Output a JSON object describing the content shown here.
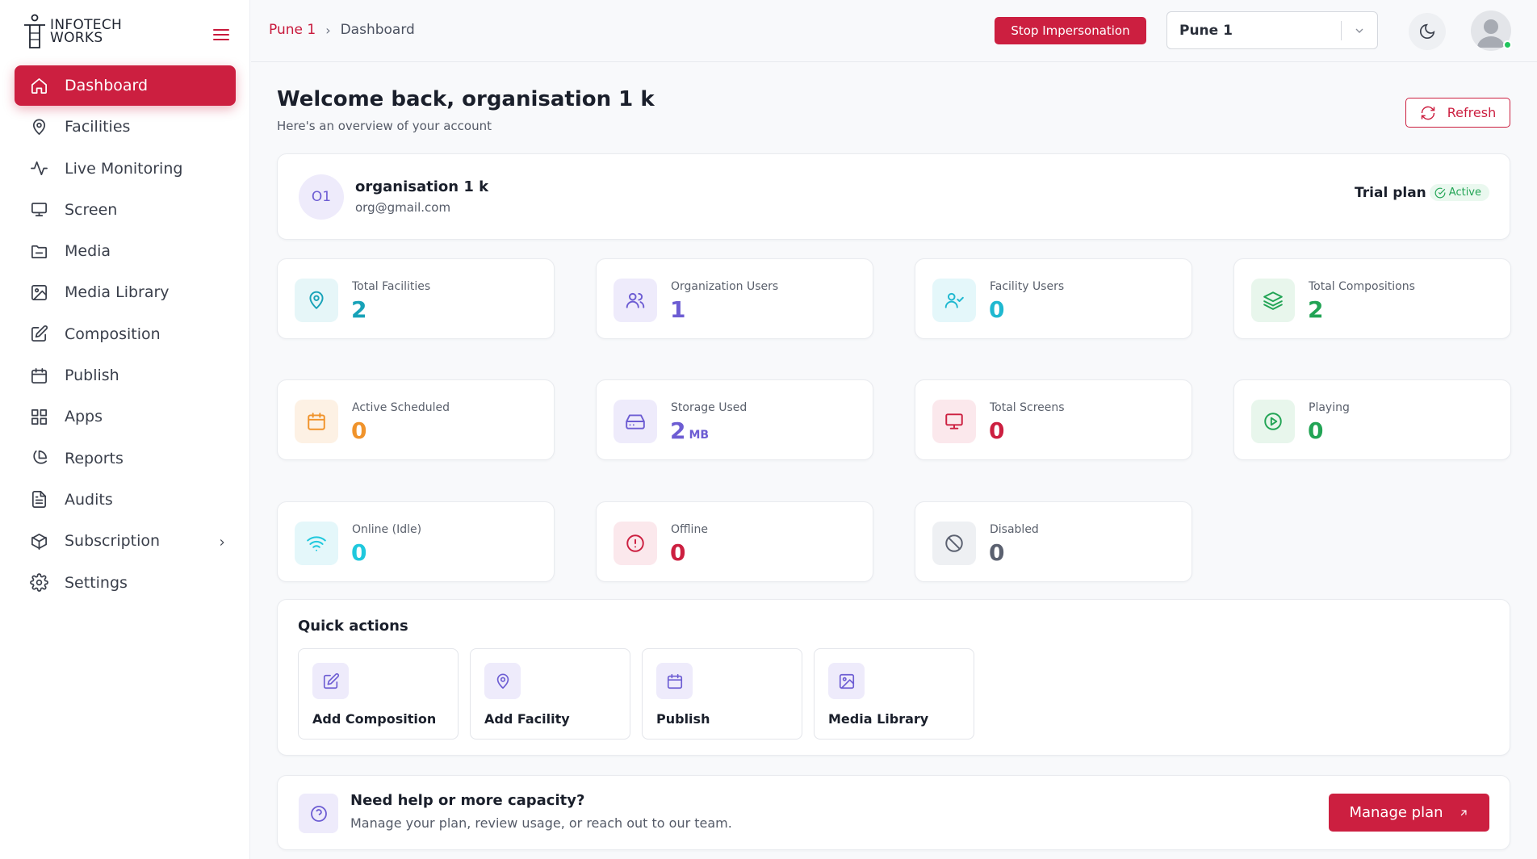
{
  "brand": {
    "line1": "INFOTECH",
    "line2": "WORKS"
  },
  "sidebar": {
    "items": [
      {
        "label": "Dashboard",
        "icon": "home-icon",
        "active": true
      },
      {
        "label": "Facilities",
        "icon": "map-pin-icon"
      },
      {
        "label": "Live Monitoring",
        "icon": "activity-icon"
      },
      {
        "label": "Screen",
        "icon": "monitor-icon"
      },
      {
        "label": "Media",
        "icon": "folder-icon"
      },
      {
        "label": "Media Library",
        "icon": "image-icon"
      },
      {
        "label": "Composition",
        "icon": "edit-icon"
      },
      {
        "label": "Publish",
        "icon": "calendar-icon"
      },
      {
        "label": "Apps",
        "icon": "grid-icon"
      },
      {
        "label": "Reports",
        "icon": "pie-chart-icon"
      },
      {
        "label": "Audits",
        "icon": "file-text-icon"
      },
      {
        "label": "Subscription",
        "icon": "package-icon",
        "has_submenu": true
      },
      {
        "label": "Settings",
        "icon": "gear-icon"
      }
    ]
  },
  "header": {
    "breadcrumb": {
      "parent": "Pune 1",
      "current": "Dashboard"
    },
    "stop_impersonation": "Stop Impersonation",
    "org_select": {
      "value": "Pune 1"
    }
  },
  "main": {
    "welcome": "Welcome back, organisation 1 k",
    "subtitle": "Here's an overview of your account",
    "refresh_label": "Refresh",
    "org": {
      "initials": "O1",
      "name": "organisation 1 k",
      "email": "org@gmail.com",
      "plan_label": "Trial plan",
      "plan_status": "Active"
    },
    "stats": [
      {
        "label": "Total Facilities",
        "value": "2",
        "unit": "",
        "icon": "map-pin-icon",
        "color": "#17a2b8",
        "bg": "#e6f6f8"
      },
      {
        "label": "Organization Users",
        "value": "1",
        "unit": "",
        "icon": "users-icon",
        "color": "#6d5dd3",
        "bg": "#eeebfb"
      },
      {
        "label": "Facility Users",
        "value": "0",
        "unit": "",
        "icon": "user-check-icon",
        "color": "#1fb8d0",
        "bg": "#e4f7fa"
      },
      {
        "label": "Total Compositions",
        "value": "2",
        "unit": "",
        "icon": "layers-icon",
        "color": "#22a455",
        "bg": "#e8f6ec"
      },
      {
        "label": "Active Scheduled",
        "value": "0",
        "unit": "",
        "icon": "calendar-icon",
        "color": "#f0932b",
        "bg": "#fdf1e4"
      },
      {
        "label": "Storage Used",
        "value": "2",
        "unit": "MB",
        "icon": "hard-drive-icon",
        "color": "#6d5dd3",
        "bg": "#eeebfb"
      },
      {
        "label": "Total Screens",
        "value": "0",
        "unit": "",
        "icon": "monitor-icon",
        "color": "#cc1f40",
        "bg": "#fbe8ec"
      },
      {
        "label": "Playing",
        "value": "0",
        "unit": "",
        "icon": "play-circle-icon",
        "color": "#22a455",
        "bg": "#e8f6ec"
      },
      {
        "label": "Online (Idle)",
        "value": "0",
        "unit": "",
        "icon": "wifi-icon",
        "color": "#1fc8dd",
        "bg": "#e4f7fa"
      },
      {
        "label": "Offline",
        "value": "0",
        "unit": "",
        "icon": "alert-circle-icon",
        "color": "#cc1f40",
        "bg": "#fbe8ec"
      },
      {
        "label": "Disabled",
        "value": "0",
        "unit": "",
        "icon": "ban-icon",
        "color": "#5b6170",
        "bg": "#eef0f3"
      }
    ],
    "quick_actions": {
      "title": "Quick actions",
      "items": [
        {
          "label": "Add Composition",
          "icon": "edit-icon"
        },
        {
          "label": "Add Facility",
          "icon": "map-pin-icon"
        },
        {
          "label": "Publish",
          "icon": "calendar-icon"
        },
        {
          "label": "Media Library",
          "icon": "image-icon"
        }
      ]
    },
    "help": {
      "title": "Need help or more capacity?",
      "subtitle": "Manage your plan, review usage, or reach out to our team.",
      "button": "Manage plan"
    }
  },
  "colors": {
    "accent": "#cc1f40",
    "purple": "#6d5dd3",
    "online": "#22c55e"
  }
}
